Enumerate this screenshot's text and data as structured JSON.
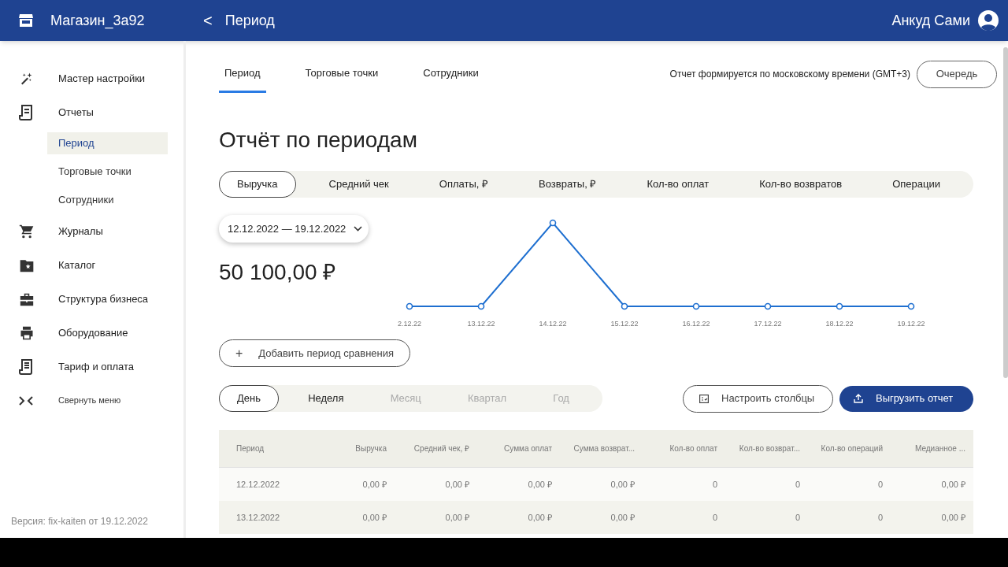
{
  "header": {
    "store": "Магазин_3a92",
    "back": "<",
    "title": "Период",
    "user": "Анкуд Сами"
  },
  "sidebar": {
    "items": [
      {
        "label": "Мастер настройки"
      },
      {
        "label": "Отчеты",
        "children": [
          {
            "label": "Период",
            "selected": true
          },
          {
            "label": "Торговые точки",
            "selected": false
          },
          {
            "label": "Сотрудники",
            "selected": false
          }
        ]
      },
      {
        "label": "Журналы"
      },
      {
        "label": "Каталог"
      },
      {
        "label": "Структура бизнеса"
      },
      {
        "label": "Оборудование"
      },
      {
        "label": "Тариф и оплата"
      }
    ],
    "collapse": "Свернуть меню",
    "version": "Версия: fix-kaiten от 19.12.2022"
  },
  "tabs": [
    {
      "label": "Период",
      "selected": true
    },
    {
      "label": "Торговые точки",
      "selected": false
    },
    {
      "label": "Сотрудники",
      "selected": false
    }
  ],
  "timezone_note": "Отчет формируется по московскому времени (GMT+3)",
  "queue_button": "Очередь",
  "page_title": "Отчёт по периодам",
  "metrics": [
    {
      "label": "Выручка",
      "selected": true
    },
    {
      "label": "Средний чек",
      "selected": false
    },
    {
      "label": "Оплаты, ₽",
      "selected": false
    },
    {
      "label": "Возвраты, ₽",
      "selected": false
    },
    {
      "label": "Кол-во оплат",
      "selected": false
    },
    {
      "label": "Кол-во возвратов",
      "selected": false
    },
    {
      "label": "Операции",
      "selected": false
    }
  ],
  "date_range": "12.12.2022 — 19.12.2022",
  "total": "50 100,00 ₽",
  "chart": {
    "x_labels": [
      "2.12.22",
      "13.12.22",
      "14.12.22",
      "15.12.22",
      "16.12.22",
      "17.12.22",
      "18.12.22",
      "19.12.22"
    ]
  },
  "compare_button": {
    "icon": "+",
    "label": "Добавить период сравнения"
  },
  "granularity": [
    {
      "label": "День",
      "selected": true,
      "disabled": false
    },
    {
      "label": "Неделя",
      "selected": false,
      "disabled": false
    },
    {
      "label": "Месяц",
      "selected": false,
      "disabled": true
    },
    {
      "label": "Квартал",
      "selected": false,
      "disabled": true
    },
    {
      "label": "Год",
      "selected": false,
      "disabled": true
    }
  ],
  "columns_button": "Настроить столбцы",
  "export_button": "Выгрузить отчет",
  "table": {
    "columns": [
      "Период",
      "Выручка",
      "Средний чек, ₽",
      "Сумма оплат",
      "Сумма возврат...",
      "Кол-во оплат",
      "Кол-во возврат...",
      "Кол-во операций",
      "Медианное ..."
    ],
    "rows": [
      [
        "12.12.2022",
        "0,00 ₽",
        "0,00 ₽",
        "0,00 ₽",
        "0,00 ₽",
        "0",
        "0",
        "0",
        "0,00 ₽"
      ],
      [
        "13.12.2022",
        "0,00 ₽",
        "0,00 ₽",
        "0,00 ₽",
        "0,00 ₽",
        "0",
        "0",
        "0",
        "0,00 ₽"
      ]
    ]
  }
}
